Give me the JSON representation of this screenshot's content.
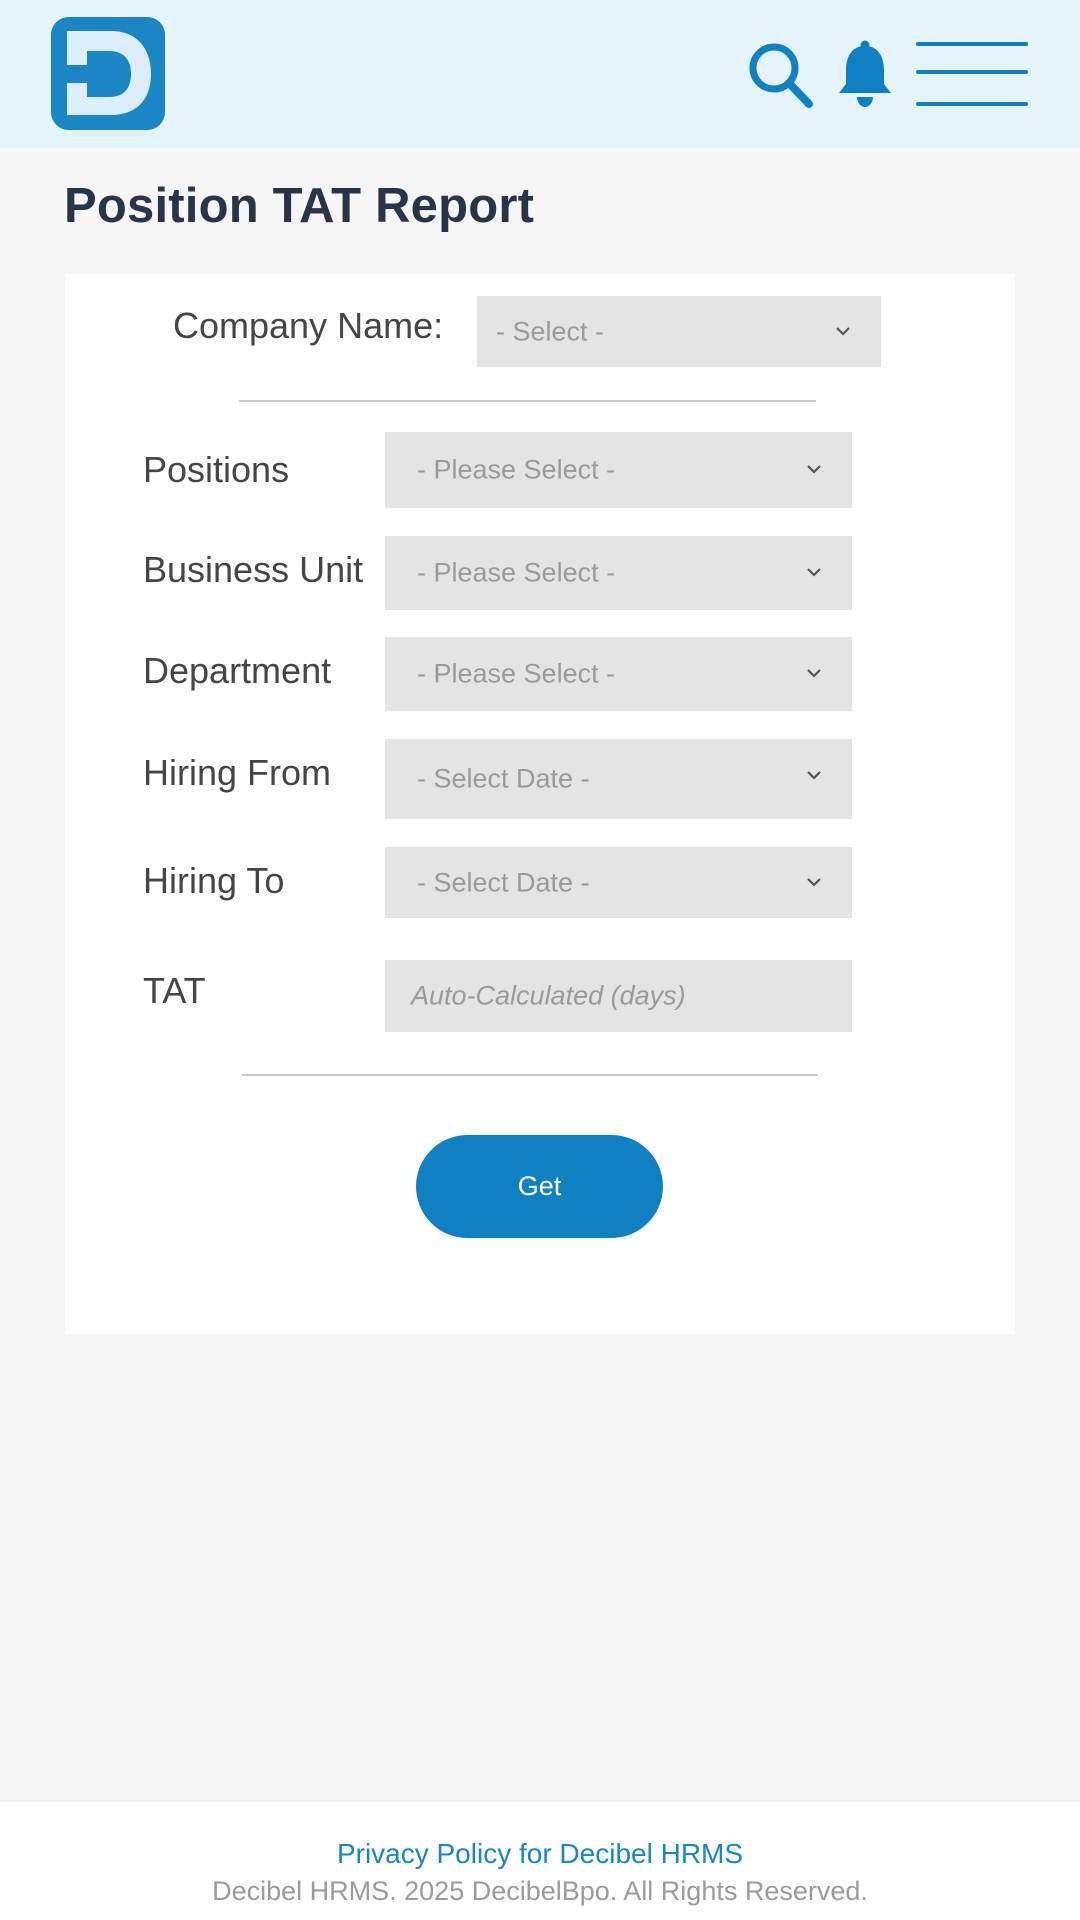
{
  "header": {
    "logo_letter": "D",
    "icons": [
      "search-icon",
      "bell-icon",
      "menu-icon"
    ],
    "accent_color": "#0f80c2",
    "header_bg": "#e5f3fb"
  },
  "page_title": "Position TAT Report",
  "form": {
    "company_label": "Company Name:",
    "company_placeholder": "- Select -",
    "fields": [
      {
        "label": "Positions",
        "placeholder": "- Please Select -"
      },
      {
        "label": "Business Unit",
        "placeholder": "- Please Select -"
      },
      {
        "label": "Department",
        "placeholder": "- Please Select -"
      },
      {
        "label": "Hiring From",
        "placeholder": "- Select Date -"
      },
      {
        "label": "Hiring To",
        "placeholder": "- Select Date -"
      },
      {
        "label": "TAT",
        "placeholder": "Auto-Calculated (days)"
      }
    ],
    "submit_label": "Get"
  },
  "footer": {
    "privacy_link": "Privacy Policy for Decibel HRMS",
    "copyright": "Decibel HRMS. 2025 DecibelBpo. All Rights Reserved."
  }
}
